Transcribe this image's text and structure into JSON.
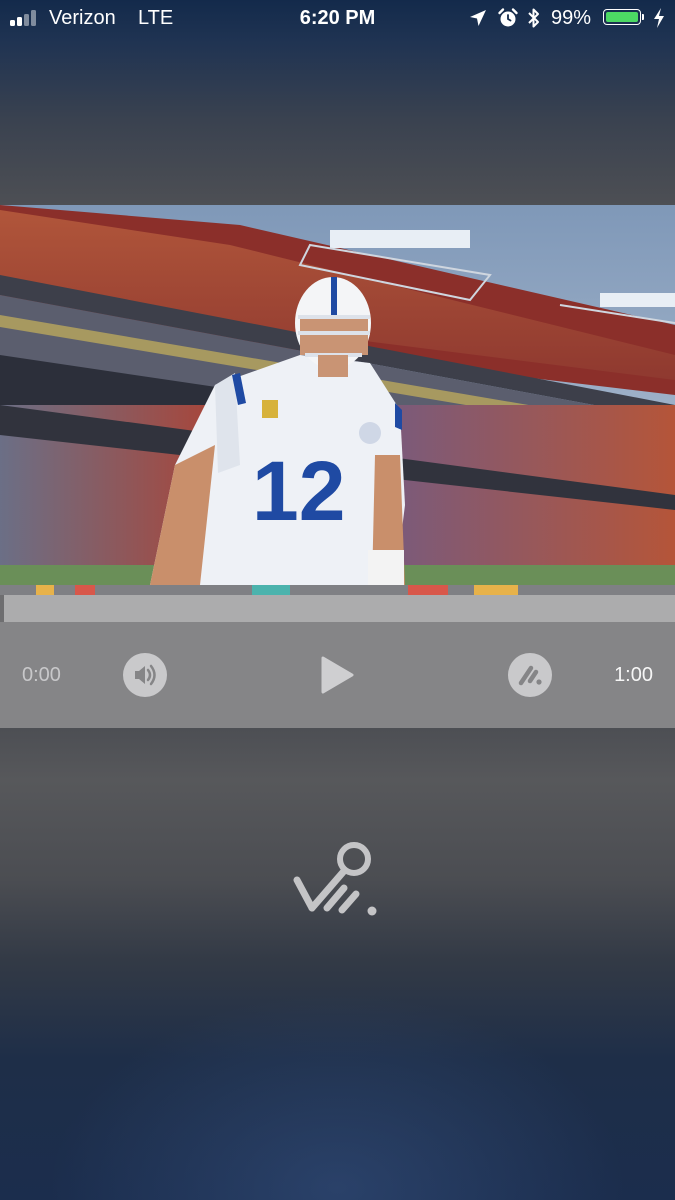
{
  "status_bar": {
    "carrier": "Verizon",
    "network": "LTE",
    "time": "6:20 PM",
    "battery_percent": "99%",
    "signal_bars": 4,
    "icons": [
      "location-arrow-icon",
      "alarm-clock-icon",
      "bluetooth-icon",
      "battery-icon",
      "charging-bolt-icon"
    ]
  },
  "video": {
    "description_icon": "video-frame"
  },
  "timeline": {
    "progress": 0,
    "marker_colors": [
      "#e7b24a",
      "#d8574a",
      "#4bb3ad",
      "#d8574a",
      "#e7b24a"
    ]
  },
  "controls": {
    "current_time": "0:00",
    "duration": "1:00",
    "volume_icon": "volume-icon",
    "play_icon": "play-icon",
    "speed_icon": "speed-icon"
  },
  "branding": {
    "logo_icon": "app-logo-icon"
  },
  "colors": {
    "battery_fill": "#4cd964",
    "controls_bg": "#858587",
    "track": "#acacad"
  }
}
